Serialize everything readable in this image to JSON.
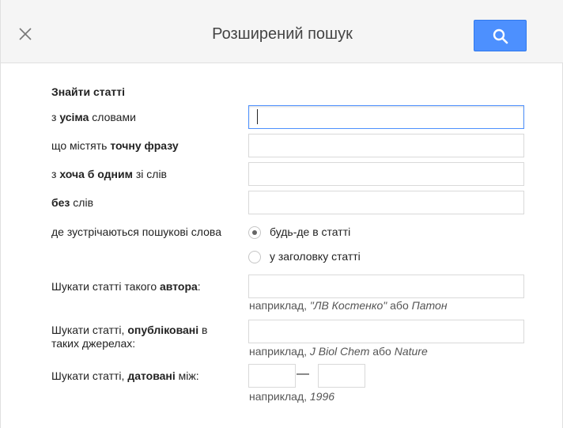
{
  "header": {
    "title": "Розширений пошук",
    "close_icon": "close-icon",
    "search_icon": "search-icon",
    "accent_color": "#4d90fe"
  },
  "form": {
    "section_title": "Знайти статті",
    "all_words": {
      "pre": "з ",
      "bold": "усіма",
      "post": " словами",
      "value": ""
    },
    "exact_phrase": {
      "pre": "що містять ",
      "bold": "точну фразу",
      "post": "",
      "value": ""
    },
    "any_words": {
      "pre": "з ",
      "bold": "хоча б одним",
      "post": " зі слів",
      "value": ""
    },
    "without_words": {
      "pre": "",
      "bold": "без",
      "post": " слів",
      "value": ""
    },
    "occurrence": {
      "label": "де зустрічаються пошукові слова",
      "option_anywhere": "будь-де в статті",
      "option_title": "у заголовку статті",
      "selected": "будь-де в статті"
    },
    "author": {
      "pre": "Шукати статті такого ",
      "bold": "автора",
      "post": ":",
      "hint_pre": "наприклад, ",
      "hint_ex1": "\"ЛВ Костенко\"",
      "hint_mid": " або ",
      "hint_ex2": "Патон"
    },
    "source": {
      "pre": "Шукати статті, ",
      "bold": "опубліковані",
      "post": " в",
      "line2": "таких джерелах:",
      "hint_pre": "наприклад, ",
      "hint_ex1": "J Biol Chem",
      "hint_mid": " або ",
      "hint_ex2": "Nature"
    },
    "dated": {
      "pre": "Шукати статті, ",
      "bold": "датовані",
      "post": " між:",
      "dash": "—",
      "hint_pre": "наприклад, ",
      "hint_ex": "1996"
    }
  }
}
